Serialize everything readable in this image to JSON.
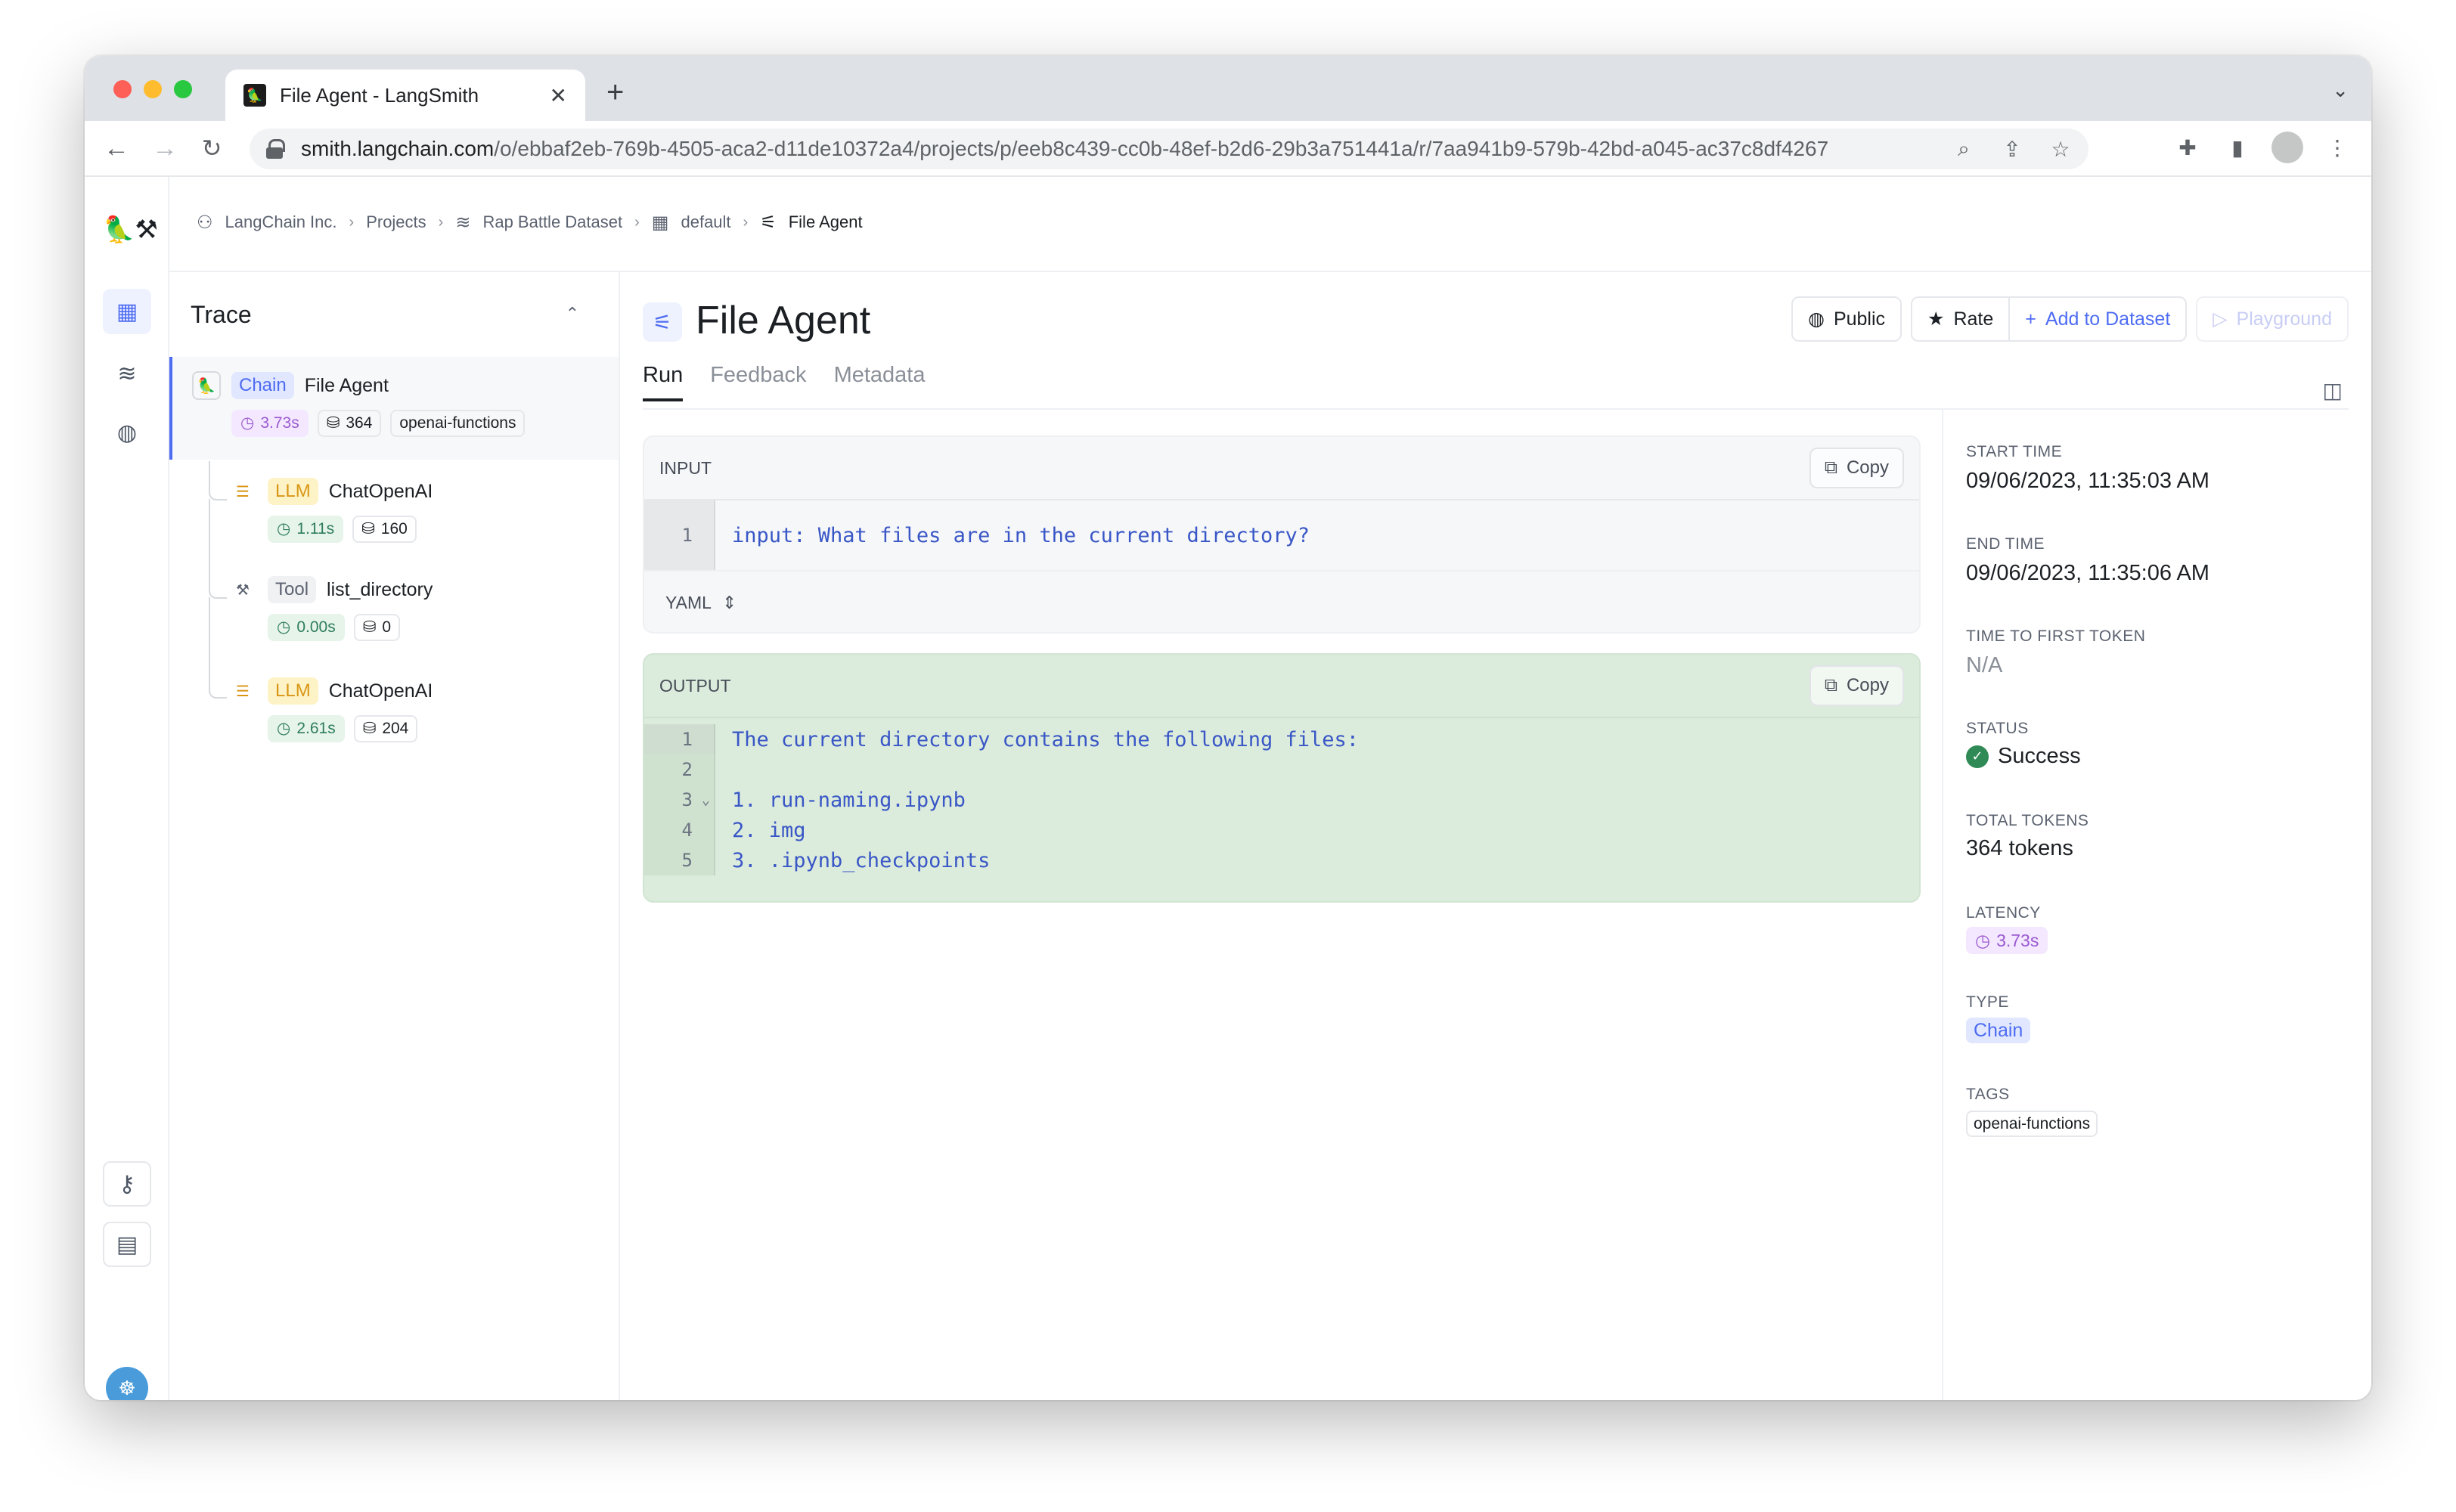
{
  "browser": {
    "tab_title": "File Agent - LangSmith",
    "url_host": "smith.langchain.com",
    "url_path": "/o/ebbaf2eb-769b-4505-aca2-d11de10372a4/projects/p/eeb8c439-cc0b-48ef-b2d6-29b3a751441a/r/7aa941b9-579b-42bd-a045-ac37c8df4267"
  },
  "breadcrumb": {
    "org": "LangChain Inc.",
    "projects": "Projects",
    "dataset": "Rap Battle Dataset",
    "default": "default",
    "current": "File Agent"
  },
  "trace": {
    "title": "Trace",
    "root": {
      "type": "Chain",
      "name": "File Agent",
      "latency": "3.73s",
      "tokens": "364",
      "tag": "openai-functions"
    },
    "children": [
      {
        "type": "LLM",
        "name": "ChatOpenAI",
        "latency": "1.11s",
        "tokens": "160"
      },
      {
        "type": "Tool",
        "name": "list_directory",
        "latency": "0.00s",
        "tokens": "0"
      },
      {
        "type": "LLM",
        "name": "ChatOpenAI",
        "latency": "2.61s",
        "tokens": "204"
      }
    ]
  },
  "run": {
    "title": "File Agent",
    "actions": {
      "public": "Public",
      "rate": "Rate",
      "add_to_dataset": "Add to Dataset",
      "playground": "Playground"
    },
    "tabs": [
      "Run",
      "Feedback",
      "Metadata"
    ],
    "input": {
      "label": "INPUT",
      "copy": "Copy",
      "lines": [
        "input: What files are in the current directory?"
      ],
      "format": "YAML"
    },
    "output": {
      "label": "OUTPUT",
      "copy": "Copy",
      "lines": [
        "The current directory contains the following files:",
        "",
        "1. run-naming.ipynb",
        "2. img",
        "3. .ipynb_checkpoints"
      ]
    }
  },
  "details": {
    "start_time_label": "START TIME",
    "start_time": "09/06/2023, 11:35:03 AM",
    "end_time_label": "END TIME",
    "end_time": "09/06/2023, 11:35:06 AM",
    "ttft_label": "TIME TO FIRST TOKEN",
    "ttft": "N/A",
    "status_label": "STATUS",
    "status": "Success",
    "tokens_label": "TOTAL TOKENS",
    "tokens": "364 tokens",
    "latency_label": "LATENCY",
    "latency": "3.73s",
    "type_label": "TYPE",
    "type": "Chain",
    "tags_label": "TAGS",
    "tag": "openai-functions"
  },
  "colors": {
    "accent": "#4e6cf2",
    "success": "#2f8a55",
    "output_bg": "#dbebdc"
  }
}
